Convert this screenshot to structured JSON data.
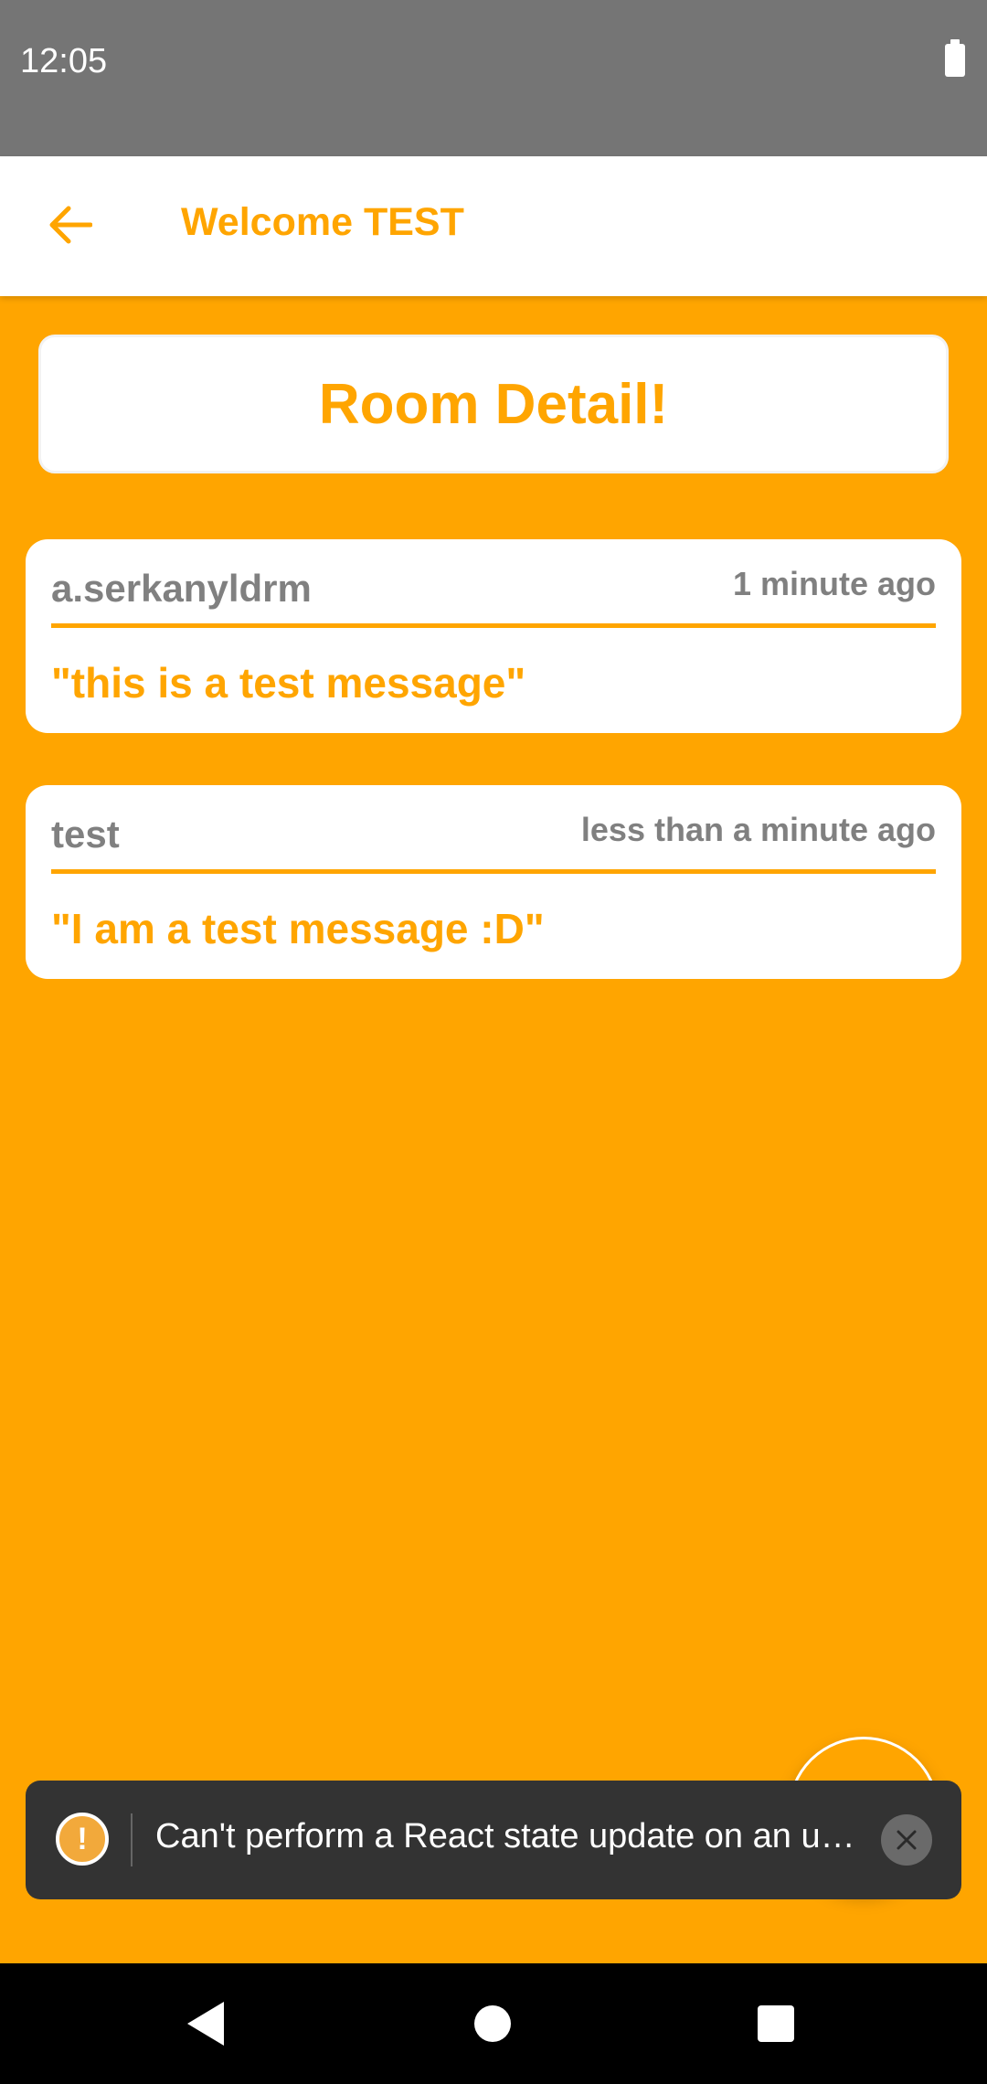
{
  "status_bar": {
    "time": "12:05",
    "battery_icon": "battery-full-icon"
  },
  "app_bar": {
    "back_icon": "arrow-left-icon",
    "title": "Welcome TEST"
  },
  "room": {
    "title": "Room Detail!"
  },
  "messages": [
    {
      "user": "a.serkanyldrm",
      "time": "1 minute ago",
      "text": "\"this is a test message\""
    },
    {
      "user": "test",
      "time": "less than a minute ago",
      "text": "\"I am a test message :D\""
    }
  ],
  "toast": {
    "icon": "warning-icon",
    "text": "Can't perform a React state update on an u…",
    "close_icon": "close-icon"
  },
  "nav_bar": {
    "back_icon": "nav-back-icon",
    "home_icon": "nav-home-icon",
    "recents_icon": "nav-recents-icon"
  },
  "colors": {
    "accent": "#FFA500",
    "status_bar": "#757575",
    "text_gray": "#808080",
    "toast_bg": "#333333"
  }
}
